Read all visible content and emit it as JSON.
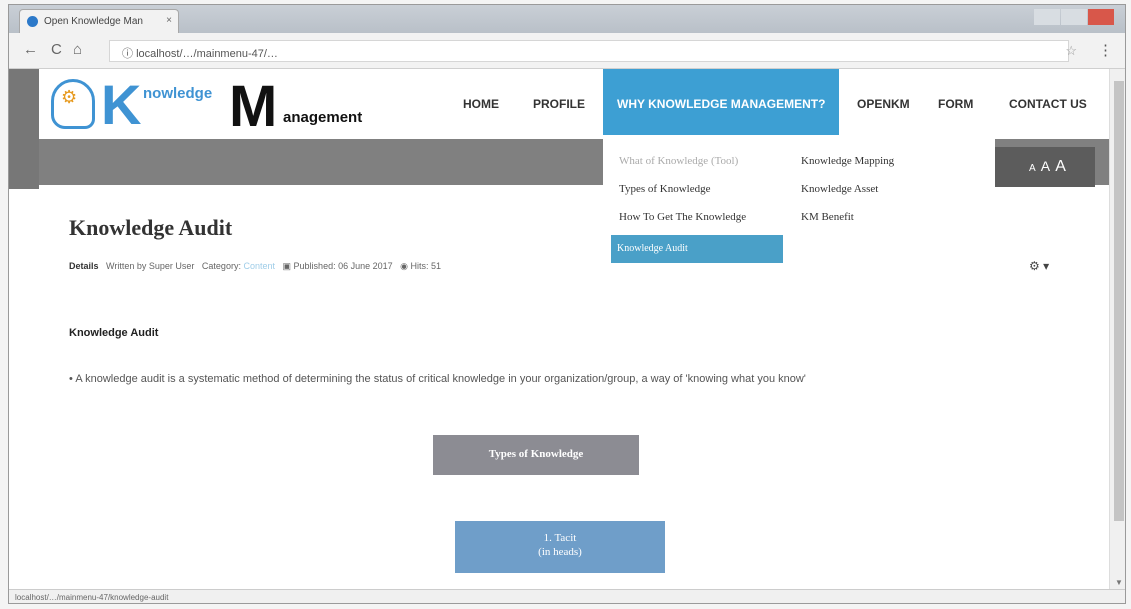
{
  "browser": {
    "tab_title": "Open Knowledge Man",
    "tab_close": "×",
    "url": "localhost/…/mainmenu-47/…",
    "status_url": "localhost/…/mainmenu-47/knowledge-audit",
    "back_icon": "←",
    "reload_icon": "C",
    "home_icon": "⌂",
    "info_icon": "ⓘ",
    "star_icon": "☆",
    "menu_icon": "⋮"
  },
  "logo": {
    "k_letter": "K",
    "k_rest": "nowledge",
    "m_letter": "M",
    "m_rest": "anagement",
    "gear_icon": "⚙"
  },
  "nav": {
    "home": "HOME",
    "profile": "PROFILE",
    "why_km": "WHY KNOWLEDGE MANAGEMENT?",
    "openkm": "OPENKM",
    "form": "FORM",
    "contact": "CONTACT US"
  },
  "dropdown": {
    "col1": [
      "What of Knowledge (Tool)",
      "Types of Knowledge",
      "How To Get The Knowledge",
      "Knowledge Audit"
    ],
    "col2": [
      "Knowledge Mapping",
      "Knowledge Asset",
      "KM Benefit"
    ]
  },
  "font_resizer": {
    "small": "A",
    "medium": "A",
    "large": "A"
  },
  "article": {
    "title": "Knowledge Audit",
    "details_label": "Details",
    "written_by": "Written by Super User",
    "category_label": "Category:",
    "category_value": "Content",
    "published": "Published: 06 June 2017",
    "hits": "Hits: 51",
    "gear_icon": "⚙ ▾",
    "sub_heading": "Knowledge Audit",
    "bullet": "A knowledge audit is a systematic method of determining the status of critical knowledge in your organization/group, a way of 'knowing what you know'",
    "box_types": "Types of Knowledge",
    "box_tacit_title": "1. Tacit",
    "box_tacit_sub": "(in heads)"
  },
  "colors": {
    "accent": "#3d9fd3",
    "hero_gray": "#808080",
    "resizer_bg": "#5c5c5c",
    "box_gray": "#8c8c93",
    "box_blue": "#6f9ec9"
  }
}
